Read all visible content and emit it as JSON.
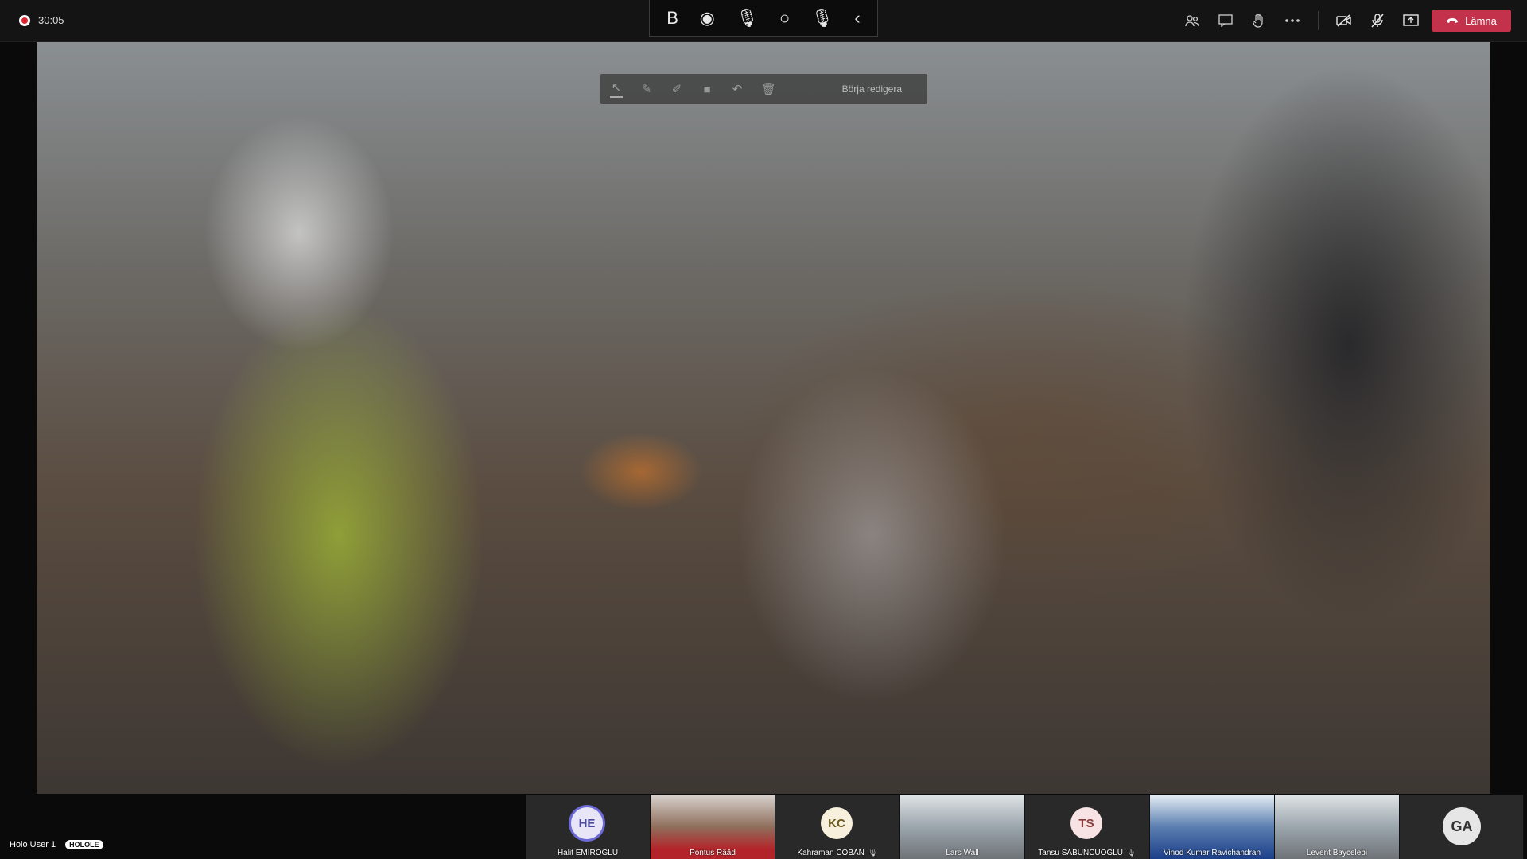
{
  "recording": {
    "timer": "30:05"
  },
  "ink_toolbar": {
    "items": [
      {
        "id": "ink-select",
        "glyph": "B"
      },
      {
        "id": "record",
        "glyph": "◉"
      },
      {
        "id": "microphone",
        "glyph": "🎙"
      },
      {
        "id": "circle",
        "glyph": "○"
      },
      {
        "id": "mic-active",
        "glyph": "🎙"
      },
      {
        "id": "collapse",
        "glyph": "‹"
      }
    ]
  },
  "meeting_controls": {
    "participants_icon": "people-icon",
    "chat_icon": "chat-icon",
    "raise_hand_icon": "hand-icon",
    "more_icon": "more-icon",
    "camera_icon": "camera-off-icon",
    "mic_icon": "mic-off-icon",
    "share_icon": "share-icon",
    "leave_label": "Lämna"
  },
  "annotation_bar": {
    "start_edit_label": "Börja redigera"
  },
  "self_view": {
    "name": "Holo User 1",
    "badge": "HOLOLE"
  },
  "participants": [
    {
      "name": "Halit EMIROGLU",
      "initials": "HE",
      "kind": "avatar",
      "bg": "#e8e6f6",
      "fg": "#4b4aa0",
      "ring": "#6b69d6"
    },
    {
      "name": "Pontus Rääd",
      "kind": "video",
      "theme": "red"
    },
    {
      "name": "Kahraman COBAN",
      "initials": "KC",
      "kind": "avatar",
      "bg": "#f6f0dc",
      "fg": "#6b5a20",
      "muted": true
    },
    {
      "name": "Lars Wall",
      "kind": "video",
      "theme": "room"
    },
    {
      "name": "Tansu SABUNCUOGLU",
      "initials": "TS",
      "kind": "avatar",
      "bg": "#f7e3e3",
      "fg": "#8a3a3a",
      "muted": true
    },
    {
      "name": "Vinod Kumar Ravichandran",
      "kind": "video",
      "theme": "blue"
    },
    {
      "name": "Levent Baycelebi",
      "kind": "video",
      "theme": "room"
    },
    {
      "name": "",
      "initials": "GA",
      "kind": "avatar",
      "bg": "#e6e6e6",
      "fg": "#333333"
    }
  ]
}
